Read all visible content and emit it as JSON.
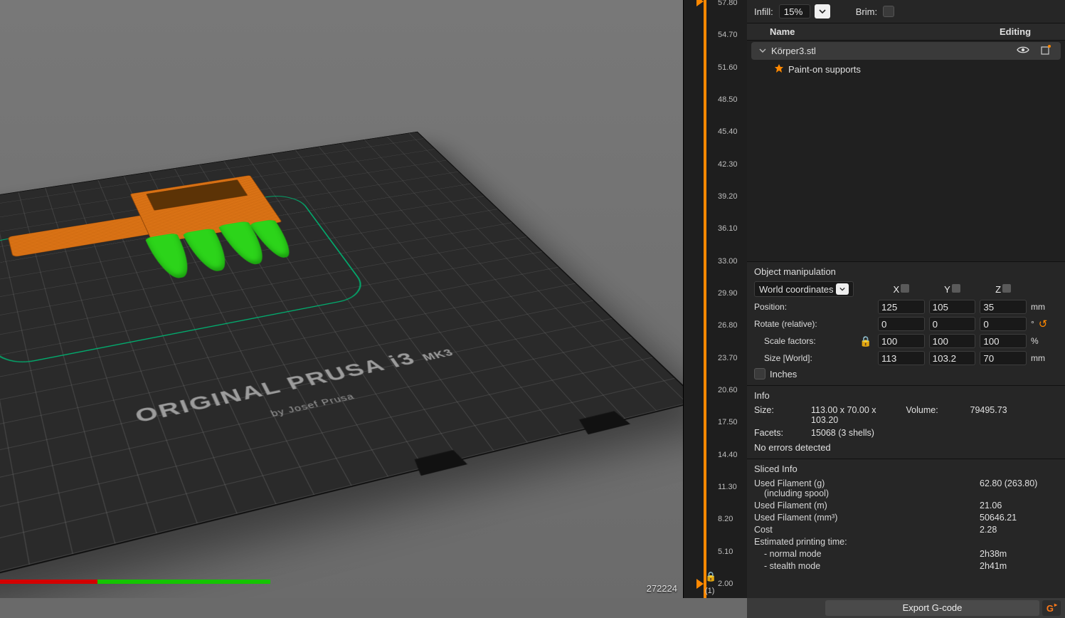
{
  "viewport": {
    "bed_label_main": "ORIGINAL PRUSA i3",
    "bed_label_mk": "MK3",
    "bed_label_sub": "by Josef Prusa",
    "counter": "272224"
  },
  "ruler": {
    "ticks_start": 57.8,
    "ticks_step": 3.1,
    "count": 19,
    "bottom_lock": "🔒",
    "one_layer_label": "(1)"
  },
  "top": {
    "infill_label": "Infill:",
    "infill_value": "15%",
    "brim_label": "Brim:"
  },
  "list": {
    "header_name": "Name",
    "header_editing": "Editing",
    "items": [
      {
        "name": "Körper3.stl",
        "eye": "eye-icon",
        "edit": "edit-icon"
      }
    ],
    "child": {
      "name": "Paint-on supports"
    }
  },
  "manip": {
    "header": "Object manipulation",
    "coord_system": "World coordinates",
    "axes": [
      "X",
      "Y",
      "Z"
    ],
    "position_label": "Position:",
    "position": [
      "125",
      "105",
      "35"
    ],
    "position_unit": "mm",
    "rotate_label": "Rotate (relative):",
    "rotate": [
      "0",
      "0",
      "0"
    ],
    "rotate_unit": "°",
    "scale_label": "Scale factors:",
    "scale": [
      "100",
      "100",
      "100"
    ],
    "scale_unit": "%",
    "size_label": "Size [World]:",
    "size": [
      "113",
      "103.2",
      "70"
    ],
    "size_unit": "mm",
    "inches_label": "Inches"
  },
  "info": {
    "header": "Info",
    "size_k": "Size:",
    "size_v": "113.00 x 70.00 x 103.20",
    "volume_k": "Volume:",
    "volume_v": "79495.73",
    "facets_k": "Facets:",
    "facets_v": "15068 (3 shells)",
    "status": "No errors detected"
  },
  "sliced": {
    "header": "Sliced Info",
    "fg_k": "Used Filament (g)",
    "fg_k2": "(including spool)",
    "fg_v": "62.80 (263.80)",
    "fm_k": "Used Filament (m)",
    "fm_v": "21.06",
    "fmm_k": "Used Filament (mm³)",
    "fmm_v": "50646.21",
    "cost_k": "Cost",
    "cost_v": "2.28",
    "time_k": "Estimated printing time:",
    "normal_k": "- normal mode",
    "normal_v": "2h38m",
    "stealth_k": "- stealth mode",
    "stealth_v": "2h41m"
  },
  "export": {
    "button": "Export G-code",
    "g_label": "G"
  }
}
